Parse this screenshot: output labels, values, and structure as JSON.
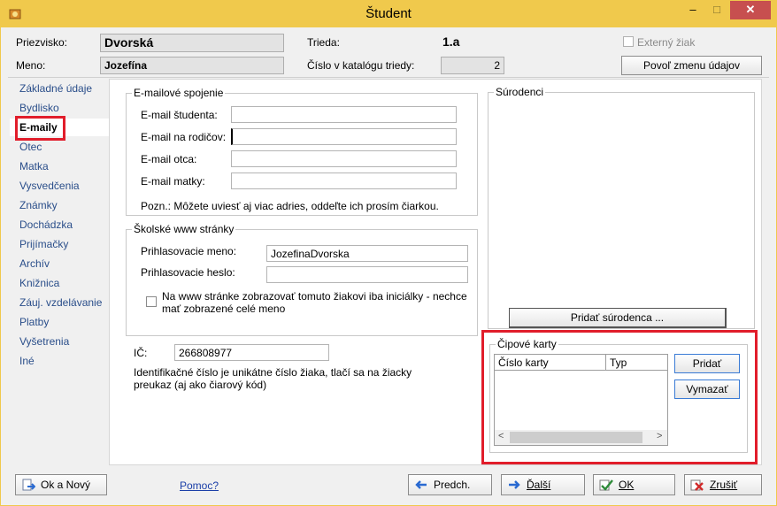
{
  "window": {
    "title": "Študent",
    "controls": {
      "minimize": "–",
      "maximize": "□",
      "close": "✕"
    }
  },
  "header": {
    "surname_label": "Priezvisko:",
    "surname_value": "Dvorská",
    "name_label": "Meno:",
    "name_value": "Jozefína",
    "class_label": "Trieda:",
    "class_value": "1.a",
    "catalog_label": "Číslo v katalógu triedy:",
    "catalog_value": "2",
    "external_label": "Externý žiak",
    "external_checked": false,
    "allow_change_button": "Povoľ zmenu údajov"
  },
  "nav": {
    "items": [
      {
        "label": "Základné údaje"
      },
      {
        "label": "Bydlisko"
      },
      {
        "label": "E-maily",
        "active": true
      },
      {
        "label": "Otec"
      },
      {
        "label": "Matka"
      },
      {
        "label": "Vysvedčenia"
      },
      {
        "label": "Známky"
      },
      {
        "label": "Dochádzka"
      },
      {
        "label": "Prijímačky"
      },
      {
        "label": "Archív"
      },
      {
        "label": "Knižnica"
      },
      {
        "label": "Záuj. vzdelávanie"
      },
      {
        "label": "Platby"
      },
      {
        "label": "Vyšetrenia"
      },
      {
        "label": "Iné"
      }
    ]
  },
  "email": {
    "legend": "E-mailové spojenie",
    "student_label": "E-mail študenta:",
    "student_value": "",
    "parents_label": "E-mail na rodičov:",
    "parents_value": "",
    "father_label": "E-mail otca:",
    "father_value": "",
    "mother_label": "E-mail matky:",
    "mother_value": "",
    "note": "Pozn.: Môžete uviesť aj viac adries, oddeľte ich prosím čiarkou."
  },
  "web": {
    "legend": "Školské www stránky",
    "login_label": "Prihlasovacie meno:",
    "login_value": "JozefinaDvorska",
    "password_label": "Prihlasovacie heslo:",
    "password_value": "",
    "initials_line1": "Na www stránke zobrazovať tomuto žiakovi iba iniciálky - nechce",
    "initials_line2": "mať zobrazené celé meno",
    "initials_checked": false
  },
  "ic": {
    "label": "IČ:",
    "value": "266808977",
    "desc_line1": "Identifikačné číslo je unikátne číslo žiaka, tlačí sa na žiacky",
    "desc_line2": "preukaz (aj ako čiarový kód)"
  },
  "siblings": {
    "legend": "Súrodenci",
    "add_button": "Pridať súrodenca ..."
  },
  "chip_cards": {
    "legend": "Čipové karty",
    "columns": [
      "Číslo karty",
      "Typ"
    ],
    "rows": [],
    "add_button": "Pridať",
    "delete_button": "Vymazať"
  },
  "footer": {
    "ok_new_button": "Ok a Nový",
    "help_link": "Pomoc?",
    "prev_button": "Predch.",
    "next_button": "Ďalší",
    "ok_button": "OK",
    "cancel_button": "Zrušiť"
  },
  "colors": {
    "titlebar": "#f0c94c",
    "close_button": "#c74f4f",
    "highlight_red": "#e11d2b",
    "nav_text": "#2a4e8a"
  }
}
